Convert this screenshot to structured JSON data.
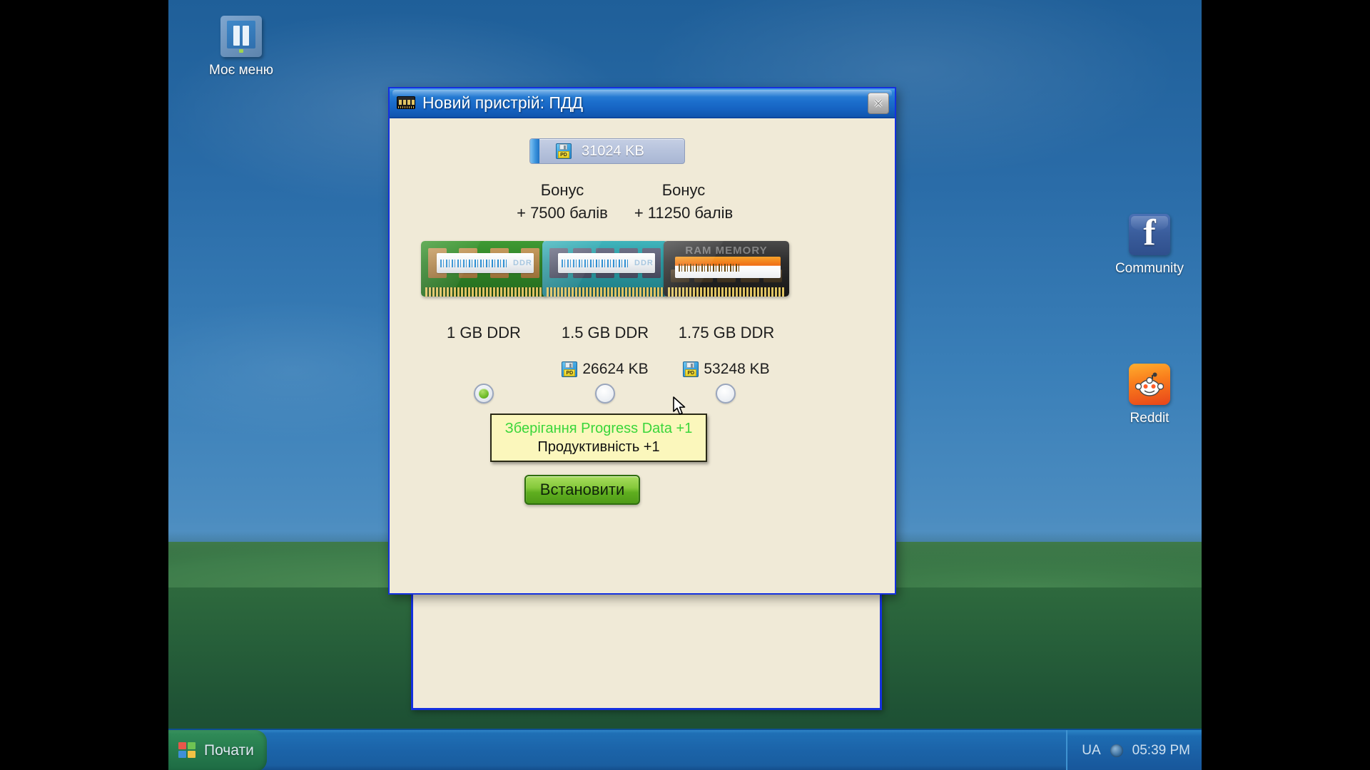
{
  "desktop": {
    "icons": [
      {
        "name": "my-menu",
        "label": "Моє меню",
        "icon": "menu-window-icon"
      },
      {
        "name": "community",
        "label": "Community",
        "icon": "facebook-icon"
      },
      {
        "name": "reddit",
        "label": "Reddit",
        "icon": "reddit-alien-icon"
      }
    ]
  },
  "taskbar": {
    "start_label": "Почати",
    "start_icon": "windows-logo-icon",
    "tray": {
      "language": "UA",
      "volume_icon": "speaker-icon",
      "clock": "05:39 PM"
    }
  },
  "dialog": {
    "title": "Новий пристрій: ПДД",
    "title_icon": "ram-module-icon",
    "close_icon": "close-icon",
    "capacity": {
      "icon": "floppy-pd-icon",
      "value": "31024 KB"
    },
    "options": [
      {
        "id": "opt-1gb",
        "name": "1 GB DDR",
        "bonus_title": "",
        "bonus_value": "",
        "price_icon": "",
        "price": "",
        "ram_color": "green",
        "ram_label": "DDR",
        "selected": true
      },
      {
        "id": "opt-15gb",
        "name": "1.5 GB DDR",
        "bonus_title": "Бонус",
        "bonus_value": "+ 7500  балів",
        "price_icon": "floppy-pd-icon",
        "price": "26624 KB",
        "ram_color": "teal",
        "ram_label": "DDR",
        "selected": false
      },
      {
        "id": "opt-175gb",
        "name": "1.75 GB DDR",
        "bonus_title": "Бонус",
        "bonus_value": "+ 11250  балів",
        "price_icon": "floppy-pd-icon",
        "price": "53248 KB",
        "ram_color": "black",
        "ram_label": "RAM MEMORY",
        "selected": false
      }
    ],
    "tooltip": {
      "line1": "Зберігання Progress Data  +1",
      "line2": "Продуктивність  +1"
    },
    "install_label": "Встановити"
  },
  "colors": {
    "accent_blue": "#1430e0",
    "title_blue": "#1c6fcc",
    "panel_cream": "#f0ead7",
    "button_green": "#5fae1f",
    "tooltip_yellow": "#fbf7bc",
    "tooltip_green_text": "#3ad63a",
    "desktop_blue": "#2a6ca8"
  }
}
